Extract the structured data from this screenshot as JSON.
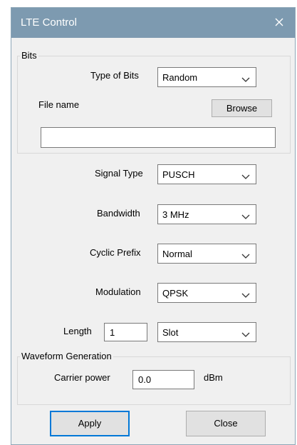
{
  "window": {
    "title": "LTE Control"
  },
  "bits": {
    "group_label": "Bits",
    "type_label": "Type of Bits",
    "type_value": "Random",
    "file_label": "File name",
    "browse_label": "Browse",
    "file_value": ""
  },
  "signal_type": {
    "label": "Signal Type",
    "value": "PUSCH"
  },
  "bandwidth": {
    "label": "Bandwidth",
    "value": "3 MHz"
  },
  "cyclic_prefix": {
    "label": "Cyclic Prefix",
    "value": "Normal"
  },
  "modulation": {
    "label": "Modulation",
    "value": "QPSK"
  },
  "length": {
    "label": "Length",
    "value": "1",
    "unit_value": "Slot"
  },
  "waveform": {
    "group_label": "Waveform Generation",
    "carrier_label": "Carrier power",
    "carrier_value": "0.0",
    "unit": "dBm"
  },
  "buttons": {
    "apply": "Apply",
    "close": "Close"
  },
  "colors": {
    "titlebar": "#7d9ab0",
    "window_bg": "#f0f0f0",
    "focus_border": "#0078d7"
  }
}
